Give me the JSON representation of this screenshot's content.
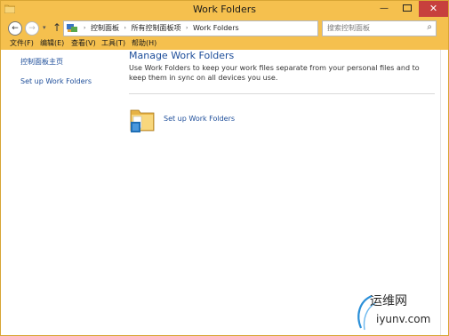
{
  "window": {
    "title": "Work Folders",
    "caption_min": "—",
    "caption_close": "✕"
  },
  "nav": {
    "back": "←",
    "forward": "→",
    "recent": "▾",
    "up": "↑"
  },
  "address": {
    "crumbs": [
      "控制面板",
      "所有控制面板项",
      "Work Folders"
    ],
    "separator": "›",
    "dropdown": "▾",
    "refresh": "↻"
  },
  "search": {
    "placeholder": "搜索控制面板",
    "icon": "⌕"
  },
  "menu": {
    "items": [
      "文件(F)",
      "编辑(E)",
      "查看(V)",
      "工具(T)",
      "帮助(H)"
    ]
  },
  "sidebar": {
    "items": [
      {
        "label": "控制面板主页"
      },
      {
        "label": "Set up Work Folders"
      }
    ]
  },
  "main": {
    "title": "Manage Work Folders",
    "description": "Use Work Folders to keep your work files separate from your personal files and to keep them in sync on all devices you use.",
    "setup_link": "Set up Work Folders"
  },
  "watermark": {
    "title": "运维网",
    "subtitle": "iyunv.com"
  },
  "colors": {
    "frame": "#f5c04e",
    "link": "#1e4e9a",
    "close": "#c7403d"
  },
  "icons": {
    "app": "folder-icon",
    "address": "control-panel-icon",
    "setup": "work-folders-icon",
    "search": "search-icon"
  }
}
